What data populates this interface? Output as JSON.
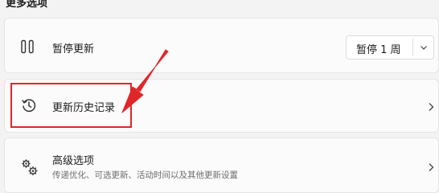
{
  "section": {
    "title": "更多选项"
  },
  "pause": {
    "icon": "pause-icon",
    "label": "暂停更新",
    "selected": "暂停 1 周",
    "dropdown_icon": "chevron-down-icon"
  },
  "history": {
    "icon": "history-icon",
    "label": "更新历史记录",
    "chevron_icon": "chevron-right-icon"
  },
  "advanced": {
    "icon": "gears-icon",
    "label": "高级选项",
    "description": "传递优化、可选更新、活动时间以及其他更新设置",
    "chevron_icon": "chevron-right-icon"
  },
  "annotation": {
    "color": "#e0262a"
  }
}
